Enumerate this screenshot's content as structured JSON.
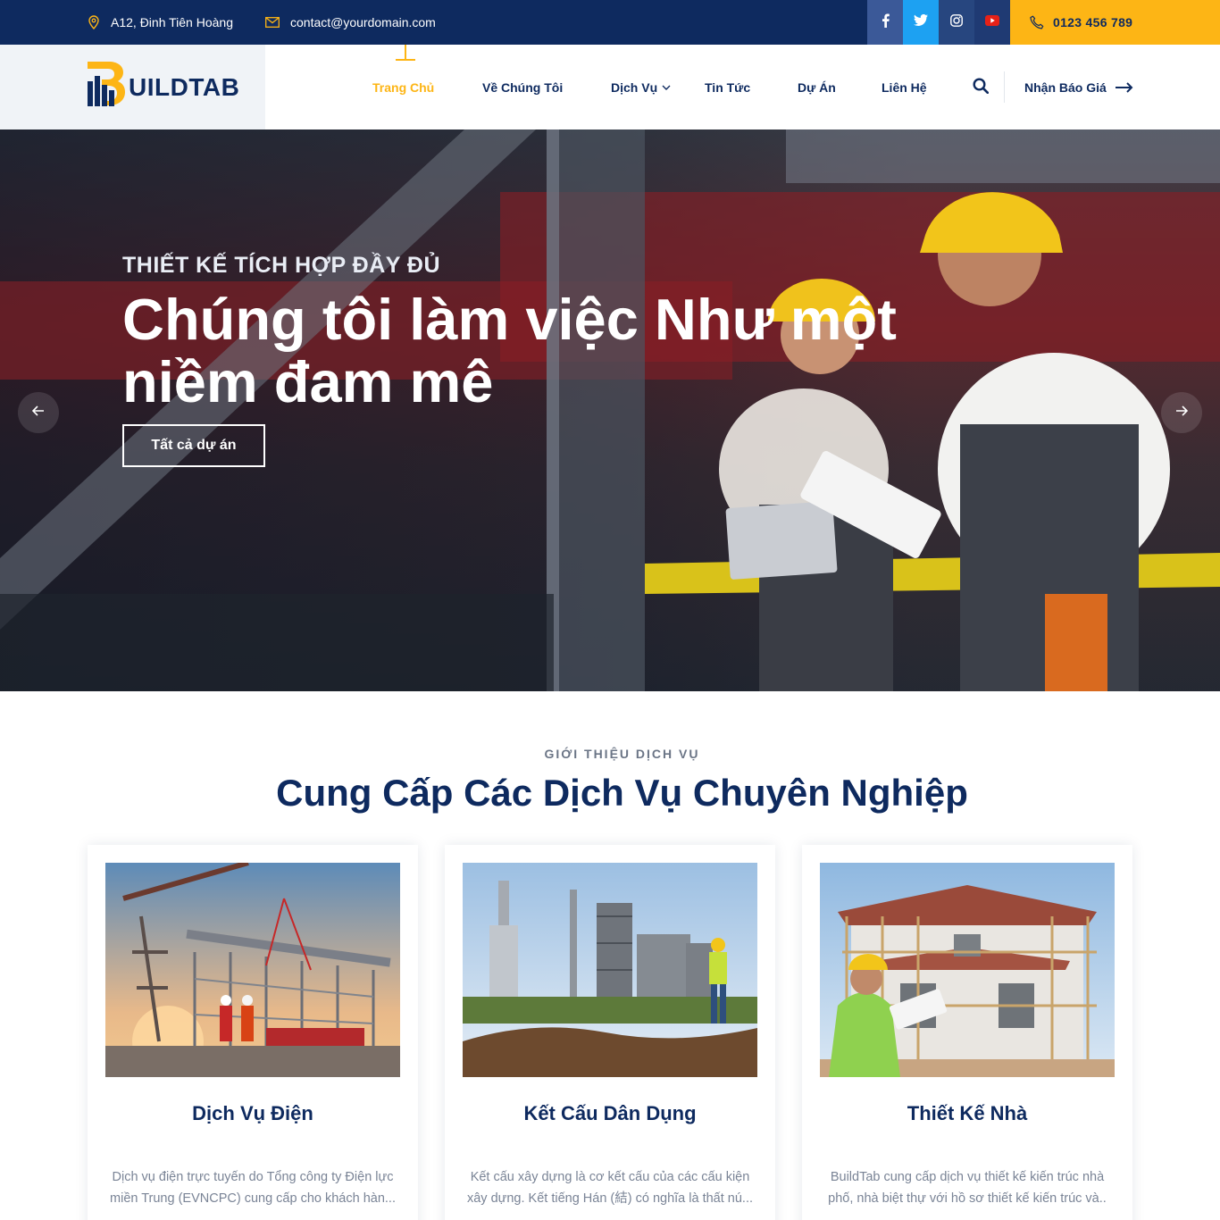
{
  "topbar": {
    "address": "A12, Đinh Tiên Hoàng",
    "email": "contact@yourdomain.com",
    "phone": "0123 456 789",
    "social": [
      "facebook-icon",
      "twitter-icon",
      "instagram-icon",
      "youtube-icon"
    ]
  },
  "header": {
    "logo_text": "UILDTAB",
    "nav": [
      {
        "label": "Trang Chủ",
        "active": true
      },
      {
        "label": "Về Chúng Tôi"
      },
      {
        "label": "Dịch Vụ",
        "has_dropdown": true
      },
      {
        "label": "Tin Tức"
      },
      {
        "label": "Dự Án"
      },
      {
        "label": "Liên Hệ"
      }
    ],
    "quote_label": "Nhận Báo Giá"
  },
  "hero": {
    "kicker": "THIẾT KẾ TÍCH HỢP ĐẦY ĐỦ",
    "title": "Chúng tôi làm việc Như một niềm đam mê",
    "button_label": "Tất cả dự án"
  },
  "services": {
    "kicker": "GIỚI THIỆU DỊCH VỤ",
    "title": "Cung Cấp Các Dịch Vụ Chuyên Nghiệp",
    "cards": [
      {
        "title": "Dịch Vụ Điện",
        "desc": "Dịch vụ điện trực tuyến do Tổng công ty Điện lực miền Trung (EVNCPC) cung cấp cho khách hàn..."
      },
      {
        "title": "Kết Cấu Dân Dụng",
        "desc": "Kết cấu xây dựng là cơ kết cấu của các cấu kiện xây dựng. Kết tiếng Hán (結) có nghĩa là thất nú..."
      },
      {
        "title": "Thiết Kế Nhà",
        "desc": "BuildTab cung cấp dịch vụ thiết kế kiến trúc nhà phố, nhà biệt thự với hồ sơ thiết kế kiến trúc và.."
      }
    ]
  },
  "colors": {
    "navy": "#0e2a5f",
    "accent": "#fdb515",
    "facebook": "#3b5998",
    "twitter": "#1da1f2"
  }
}
